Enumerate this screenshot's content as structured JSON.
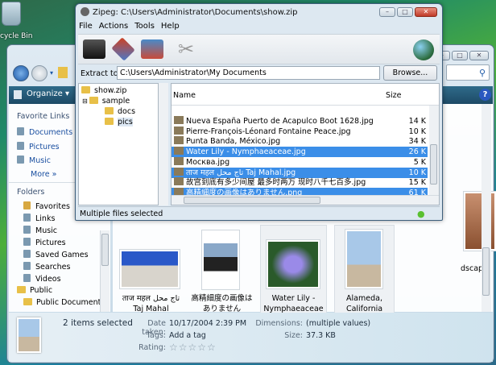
{
  "desktop": {
    "recycle_bin_label": "cycle Bin"
  },
  "explorer": {
    "toolbar": {
      "organize_label": "Organize ▾"
    },
    "favorite_links": {
      "heading": "Favorite Links",
      "items": [
        "Documents",
        "Pictures",
        "Music"
      ],
      "more": "More  »"
    },
    "folders": {
      "heading": "Folders",
      "items": [
        "Favorites",
        "Links",
        "Music",
        "Pictures",
        "Saved Games",
        "Searches",
        "Videos"
      ],
      "public": "Public",
      "public_documents": "Public Documents"
    },
    "items": [
      {
        "line1": "ताज महल تاج محل",
        "line2": "Taj Mahal"
      },
      {
        "line1": "高精細度の画像は",
        "line2": "ありません"
      },
      {
        "line1": "Water Lily -",
        "line2": "Nymphaeaceae"
      },
      {
        "line1": "Alameda,",
        "line2": "California"
      },
      {
        "line1": "dscape",
        "line2": ""
      }
    ],
    "details": {
      "selection": "2 items selected",
      "date_label": "Date taken:",
      "date_value": "10/17/2004 2:39 PM",
      "tags_label": "Tags:",
      "tags_value": "Add a tag",
      "rating_label": "Rating:",
      "rating_value": 0,
      "rating_stars": "☆☆☆☆☆",
      "dim_label": "Dimensions:",
      "dim_value": "(multiple values)",
      "size_label": "Size:",
      "size_value": "37.3 KB"
    }
  },
  "zipeg": {
    "title": "Zipeg: C:\\Users\\Administrator\\Documents\\show.zip",
    "menu": [
      "File",
      "Actions",
      "Tools",
      "Help"
    ],
    "extract_label": "Extract to:",
    "extract_value": "C:\\Users\\Administrator\\My Documents",
    "browse_label": "Browse...",
    "tree": [
      "show.zip",
      "sample",
      "docs",
      "pics"
    ],
    "columns": {
      "name": "Name",
      "size": "Size"
    },
    "files": [
      {
        "name": "Nueva España Puerto de Acapulco Boot 1628.jpg",
        "size": "14 K",
        "selected": false
      },
      {
        "name": "Pierre-François-Léonard Fontaine Peace.jpg",
        "size": "10 K",
        "selected": false
      },
      {
        "name": "Punta Banda, México.jpg",
        "size": "34 K",
        "selected": false
      },
      {
        "name": "Water Lily - Nymphaeaceae.jpg",
        "size": "26 K",
        "selected": true
      },
      {
        "name": "Москва.jpg",
        "size": "5 K",
        "selected": false
      },
      {
        "name": "ताज महल تاج محل Taj Mahal.jpg",
        "size": "10 K",
        "selected": true
      },
      {
        "name": "故宫到底有多少间屋 最多时两万 现时八千七百多.jpg",
        "size": "15 K",
        "selected": false
      },
      {
        "name": "高精細度の画像はありません.png",
        "size": "61 K",
        "selected": true
      }
    ],
    "status": "Multiple files selected"
  }
}
